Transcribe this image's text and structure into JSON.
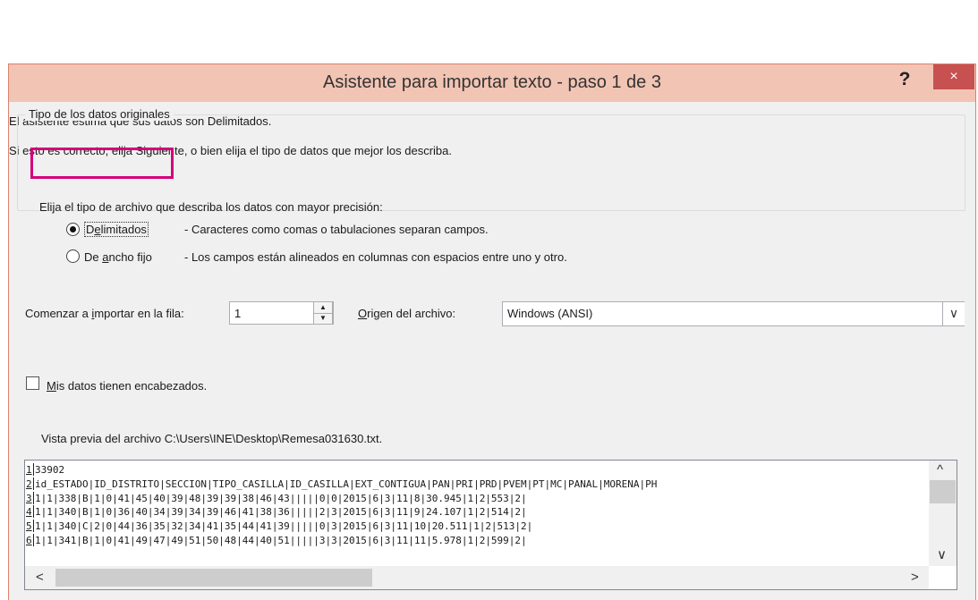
{
  "dialog": {
    "title": "Asistente para importar texto - paso 1 de 3",
    "help_label": "?",
    "close_label": "×"
  },
  "intro": {
    "line1": "El asistente estima que sus datos son Delimitados.",
    "line2": "Si esto es correcto, elija Siguiente, o bien elija el tipo de datos que mejor los describa."
  },
  "data_type_group": {
    "label": "Tipo de los datos originales",
    "instruction": "Elija el tipo de archivo que describa los datos con mayor precisión:",
    "options": [
      {
        "label_pre": "D",
        "label_access": "e",
        "label_post": "limitados",
        "description": "- Caracteres como comas o tabulaciones separan campos.",
        "selected": true
      },
      {
        "label_pre": "De ",
        "label_access": "a",
        "label_post": "ncho fijo",
        "description": "- Los campos están alineados en columnas con espacios entre uno y otro.",
        "selected": false
      }
    ]
  },
  "start_row": {
    "label_pre": "Comenzar a ",
    "label_access": "i",
    "label_post": "mportar en la fila:",
    "value": "1"
  },
  "origin": {
    "label_access": "O",
    "label_post": "rigen del archivo:",
    "value": "Windows (ANSI)"
  },
  "headers_checkbox": {
    "label_access": "M",
    "label_post": "is datos tienen encabezados.",
    "checked": false
  },
  "preview": {
    "label": "Vista previa del archivo C:\\Users\\INE\\Desktop\\Remesa031630.txt.",
    "rows": [
      {
        "num": "1",
        "text": "33902"
      },
      {
        "num": "2",
        "text": "id_ESTADO|ID_DISTRITO|SECCION|TIPO_CASILLA|ID_CASILLA|EXT_CONTIGUA|PAN|PRI|PRD|PVEM|PT|MC|PANAL|MORENA|PH"
      },
      {
        "num": "3",
        "text": "1|1|338|B|1|0|41|45|40|39|48|39|39|38|46|43|||||0|0|2015|6|3|11|8|30.945|1|2|553|2|"
      },
      {
        "num": "4",
        "text": "1|1|340|B|1|0|36|40|34|39|34|39|46|41|38|36|||||2|3|2015|6|3|11|9|24.107|1|2|514|2|"
      },
      {
        "num": "5",
        "text": "1|1|340|C|2|0|44|36|35|32|34|41|35|44|41|39|||||0|3|2015|6|3|11|10|20.511|1|2|513|2|"
      },
      {
        "num": "6",
        "text": "1|1|341|B|1|0|41|49|47|49|51|50|48|44|40|51|||||3|3|2015|6|3|11|11|5.978|1|2|599|2|"
      }
    ]
  },
  "icons": {
    "spin_up": "▲",
    "spin_down": "▼",
    "dropdown": "∨",
    "scroll_up": "^",
    "scroll_down": "∨",
    "scroll_left": "<",
    "scroll_right": ">"
  },
  "colors": {
    "titlebar": "#f2c4b3",
    "close_button": "#c75050",
    "highlight": "#d4007a"
  }
}
